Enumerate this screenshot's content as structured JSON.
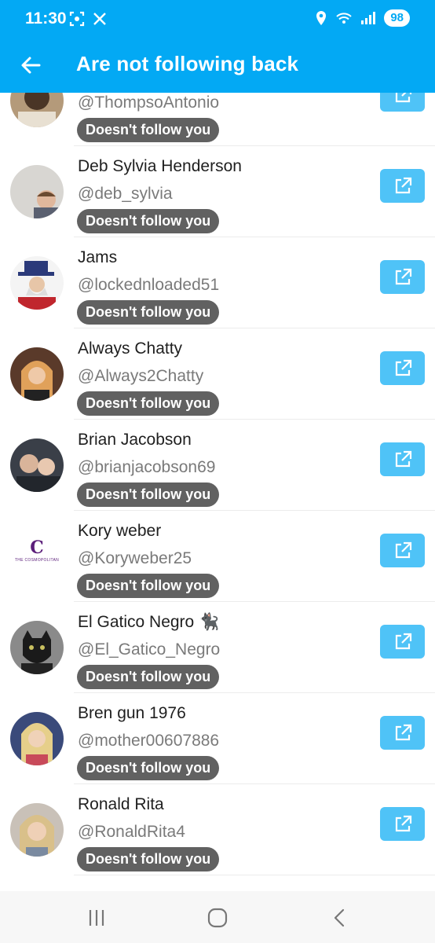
{
  "status_bar": {
    "time": "11:30",
    "icons_left": [
      "screenshot-icon",
      "x-logo-icon"
    ],
    "icons_right": [
      "location-icon",
      "wifi-icon",
      "signal-icon"
    ],
    "battery": "98"
  },
  "app_bar": {
    "title": "Are not following back",
    "background": "#03A9F4"
  },
  "badge_color": "#616161",
  "button_color": "#4FC3F7",
  "users": [
    {
      "name": "",
      "handle": "@ThompsoAntonio",
      "badge": "Doesn't follow you"
    },
    {
      "name": "Deb Sylvia Henderson",
      "handle": "@deb_sylvia",
      "badge": "Doesn't follow you"
    },
    {
      "name": "Jams",
      "handle": "@lockednloaded51",
      "badge": "Doesn't follow you"
    },
    {
      "name": "Always Chatty",
      "handle": "@Always2Chatty",
      "badge": "Doesn't follow you"
    },
    {
      "name": "Brian Jacobson",
      "handle": "@brianjacobson69",
      "badge": "Doesn't follow you"
    },
    {
      "name": "Kory weber",
      "handle": "@Koryweber25",
      "badge": "Doesn't follow you",
      "avatar_text": "C",
      "avatar_caption": "THE COSMOPOLITAN"
    },
    {
      "name": "El Gatico Negro 🐈‍⬛",
      "handle": "@El_Gatico_Negro",
      "badge": "Doesn't follow you"
    },
    {
      "name": "Bren gun 1976",
      "handle": "@mother00607886",
      "badge": "Doesn't follow you"
    },
    {
      "name": "Ronald Rita",
      "handle": "@RonaldRita4",
      "badge": "Doesn't follow you"
    }
  ],
  "nav_bar": {
    "items": [
      "recents-icon",
      "home-icon",
      "back-icon"
    ]
  }
}
